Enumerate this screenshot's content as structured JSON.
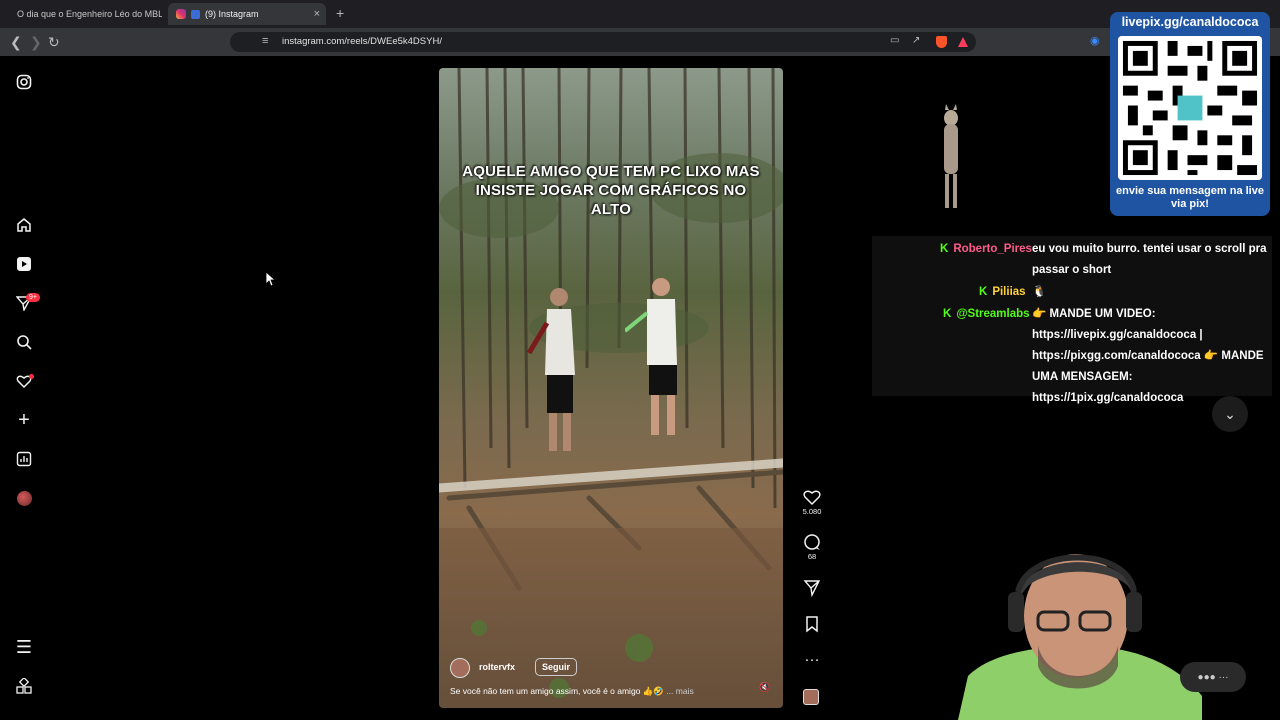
{
  "browser": {
    "tabs": [
      {
        "label": "O dia que o Engenheiro Léo do MBL",
        "active": false,
        "favicon": "youtube-icon"
      },
      {
        "label": "(9) Instagram",
        "active": true,
        "favicon": "instagram-icon"
      }
    ],
    "close_glyph": "×",
    "new_tab_glyph": "+",
    "url": "instagram.com/reels/DWEe5k4DSYH/"
  },
  "sidebar": {
    "items": [
      {
        "name": "instagram-logo-icon"
      },
      {
        "name": "home-icon"
      },
      {
        "name": "reels-icon"
      },
      {
        "name": "messages-icon",
        "badge": "9+"
      },
      {
        "name": "search-icon"
      },
      {
        "name": "notifications-icon"
      },
      {
        "name": "create-icon"
      },
      {
        "name": "dashboard-icon"
      },
      {
        "name": "profile-avatar"
      },
      {
        "name": "menu-icon"
      },
      {
        "name": "more-apps-icon"
      }
    ]
  },
  "reel": {
    "overlay_text": "AQUELE AMIGO QUE TEM PC LIXO MAS INSISTE JOGAR COM GRÁFICOS NO ALTO",
    "username": "roltervfx",
    "follow_label": "Seguir",
    "caption": "Se você não tem um amigo assim, você é o amigo 👍🤣",
    "more_label": "... mais",
    "likes": "5.080",
    "comments": "68"
  },
  "stream_overlay": {
    "qr_header": "livepix.gg/canaldococa",
    "qr_footer": "envie sua mensagem na live via pix!",
    "chat": [
      {
        "user": "Roberto_Pires",
        "user_color": "#ff5a8a",
        "text": "eu vou muito burro. tentei usar o scroll pra passar o short"
      },
      {
        "user": "Piliias",
        "user_color": "#ffd23a",
        "text": "🐧"
      },
      {
        "user": "@Streamlabs",
        "user_color": "#53fc18",
        "text": "👉 MANDE UM VIDEO: https://livepix.gg/canaldococa | https://pixgg.com/canaldococa 👉 MANDE UMA MENSAGEM: https://1pix.gg/canaldococa"
      }
    ],
    "badge_letter": "K"
  }
}
